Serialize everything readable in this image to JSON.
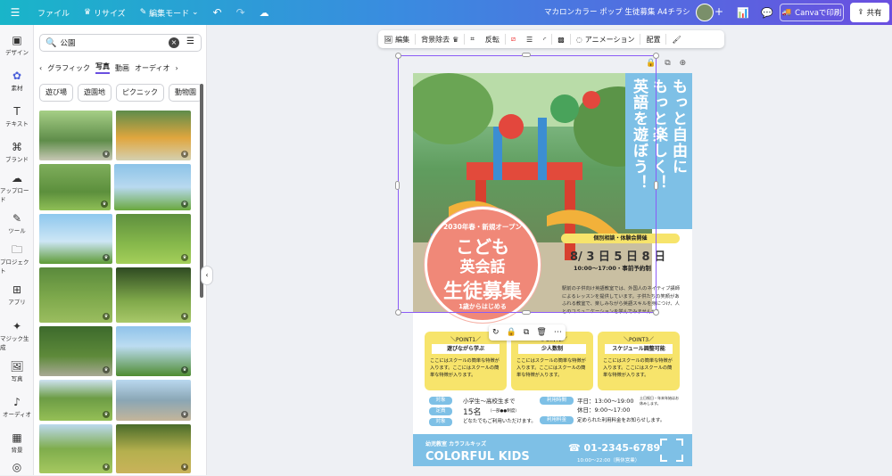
{
  "topbar": {
    "file": "ファイル",
    "resize": "リサイズ",
    "edit_mode": "編集モード",
    "doc_title": "マカロンカラー ポップ 生徒募集 A4チラシ",
    "print": "Canvaで印刷",
    "share": "共有"
  },
  "rail": [
    {
      "label": "デザイン",
      "icon": "design-icon"
    },
    {
      "label": "素材",
      "icon": "elements-icon"
    },
    {
      "label": "テキスト",
      "icon": "text-icon"
    },
    {
      "label": "ブランド",
      "icon": "brand-icon"
    },
    {
      "label": "アップロード",
      "icon": "upload-icon"
    },
    {
      "label": "ツール",
      "icon": "tools-icon"
    },
    {
      "label": "プロジェクト",
      "icon": "folder-icon"
    },
    {
      "label": "アプリ",
      "icon": "apps-icon"
    },
    {
      "label": "マジック生成",
      "icon": "magic-icon"
    },
    {
      "label": "写真",
      "icon": "photo-icon"
    },
    {
      "label": "オーディオ",
      "icon": "audio-icon"
    },
    {
      "label": "背景",
      "icon": "background-icon"
    }
  ],
  "panel": {
    "search_value": "公園",
    "tabs": [
      "グラフィック",
      "写真",
      "動画",
      "オーディオ"
    ],
    "chips": [
      "遊び場",
      "遊園地",
      "ピクニック",
      "動物園"
    ]
  },
  "ctx": {
    "edit": "編集",
    "bg_remove": "背景除去",
    "flip": "反転",
    "animate": "アニメーション",
    "position": "配置"
  },
  "poster": {
    "vtext_1": "もっと自由に",
    "vtext_2": "もっと楽しく！",
    "vtext_3": "英語を遊ぼう！",
    "circle_top": "2030年春・新規オープン",
    "circle_1": "こども",
    "circle_2": "英会話",
    "circle_3": "生徒募集",
    "circle_bottom": "1歳からはじめる",
    "consult": "個別相談・体験会開催",
    "dates": "8/ 3 日 5 日 8 日",
    "times": "10:00～17:00・事前予約制",
    "desc": "駅前の子供向け英語教室では、外国人のネイティブ講師によるレッスンを提供しています。子供たちの笑顔があふれる教室で、楽しみながら英語スキルを身につけ、人とのコミュニケーションを学んでみませんか？",
    "points": [
      {
        "label": "＼POINT1／",
        "title": "遊びながら学ぶ",
        "text": "ここにはスクールの簡単な特徴が入ります。ここにはスクールの簡単な特徴が入ります。"
      },
      {
        "label": "＼POINT2／",
        "title": "少人数制",
        "text": "ここにはスクールの簡単な特徴が入ります。ここにはスクールの簡単な特徴が入ります。"
      },
      {
        "label": "＼POINT3／",
        "title": "スケジュール調整可能",
        "text": "ここにはスクールの簡単な特徴が入ります。ここにはスクールの簡単な特徴が入ります。"
      }
    ],
    "info": {
      "target_tag": "対象",
      "target": "小学生～高校生まで",
      "capacity_tag": "定員",
      "capacity": "15名",
      "capacity_note": "（一部●●制度）",
      "fee_tag": "対象",
      "fee": "どなたでもご利用いただけます。",
      "hours_tag": "利用時間",
      "weekday": "平日：13:00～19:00",
      "holiday": "休日：9:00～17:00",
      "hours_note": "土日祝日・年末年始はお休みします。",
      "price_tag": "利用料金",
      "price": "定められた利用料金をお知らせします。"
    },
    "footer": {
      "small": "幼児教室 カラフルキッズ",
      "name": "COLORFUL KIDS",
      "tel": "01-2345-6789",
      "hours": "10:00～22:00（無休営業）"
    }
  },
  "colors": {
    "accent": "#8b5cf6",
    "blue": "#7ec0e6",
    "yellow": "#f7e46b",
    "coral": "#f08878"
  }
}
